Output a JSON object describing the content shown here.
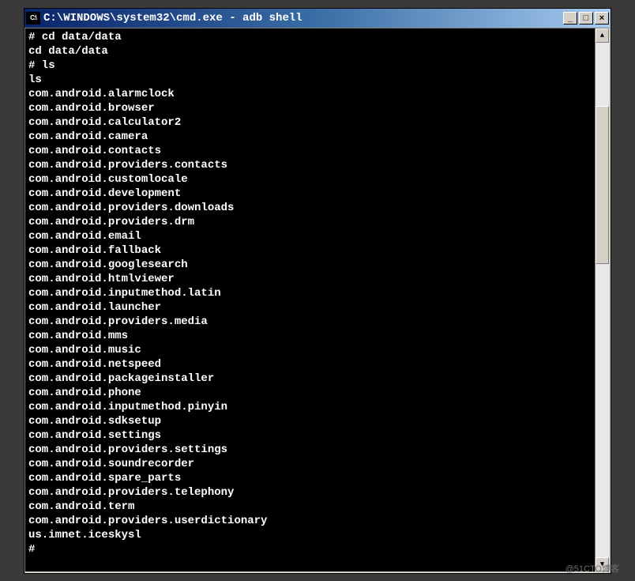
{
  "titlebar": {
    "icon_text": "C:\\",
    "title": "C:\\WINDOWS\\system32\\cmd.exe - adb shell"
  },
  "window_controls": {
    "minimize": "_",
    "maximize": "□",
    "close": "×"
  },
  "terminal": {
    "lines": [
      "# cd data/data",
      "cd data/data",
      "# ls",
      "ls",
      "com.android.alarmclock",
      "com.android.browser",
      "com.android.calculator2",
      "com.android.camera",
      "com.android.contacts",
      "com.android.providers.contacts",
      "com.android.customlocale",
      "com.android.development",
      "com.android.providers.downloads",
      "com.android.providers.drm",
      "com.android.email",
      "com.android.fallback",
      "com.android.googlesearch",
      "com.android.htmlviewer",
      "com.android.inputmethod.latin",
      "com.android.launcher",
      "com.android.providers.media",
      "com.android.mms",
      "com.android.music",
      "com.android.netspeed",
      "com.android.packageinstaller",
      "com.android.phone",
      "com.android.inputmethod.pinyin",
      "com.android.sdksetup",
      "com.android.settings",
      "com.android.providers.settings",
      "com.android.soundrecorder",
      "com.android.spare_parts",
      "com.android.providers.telephony",
      "com.android.term",
      "com.android.providers.userdictionary",
      "us.imnet.iceskysl",
      "#"
    ]
  },
  "scrollbar": {
    "up_arrow": "▲",
    "down_arrow": "▼"
  },
  "watermark": "@51CTO博客"
}
